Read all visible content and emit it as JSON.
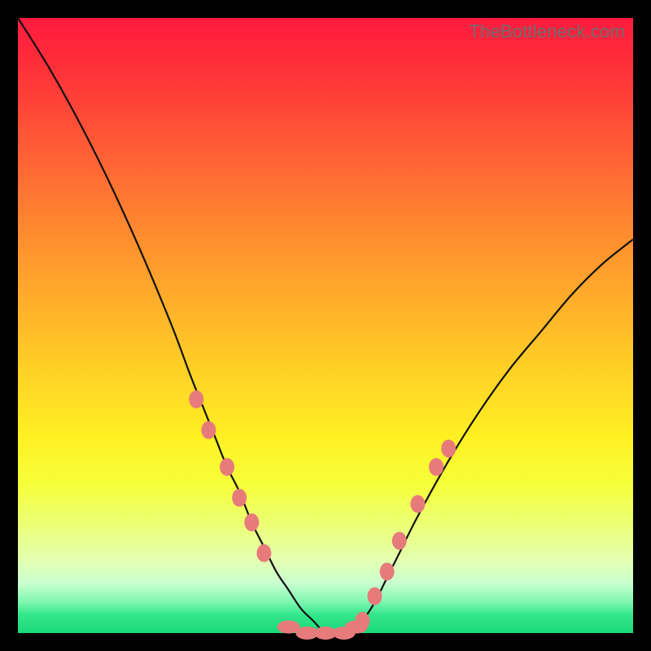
{
  "watermark": "TheBottleneck.com",
  "colors": {
    "frame": "#000000",
    "curve": "#111111",
    "blob": "#e77b7b",
    "gradient_top": "#ff1a3f",
    "gradient_bottom": "#19d877"
  },
  "chart_data": {
    "type": "line",
    "title": "",
    "xlabel": "",
    "ylabel": "",
    "xlim": [
      0,
      100
    ],
    "ylim": [
      0,
      100
    ],
    "x": [
      0,
      5,
      10,
      15,
      20,
      25,
      28,
      30,
      32,
      34,
      36,
      38,
      40,
      42,
      44,
      46,
      48,
      50,
      52,
      54,
      56,
      58,
      60,
      62,
      65,
      70,
      75,
      80,
      85,
      90,
      95,
      100
    ],
    "y": [
      100,
      92,
      83,
      73,
      62,
      50,
      42,
      37,
      32,
      27,
      23,
      18,
      14,
      10,
      7,
      4,
      2,
      0,
      0,
      0,
      2,
      5,
      9,
      13,
      19,
      28,
      36,
      43,
      49,
      55,
      60,
      64
    ],
    "markers": {
      "left_arm": [
        {
          "x": 29,
          "y": 38
        },
        {
          "x": 31,
          "y": 33
        },
        {
          "x": 34,
          "y": 27
        },
        {
          "x": 36,
          "y": 22
        },
        {
          "x": 38,
          "y": 18
        },
        {
          "x": 40,
          "y": 13
        }
      ],
      "right_arm": [
        {
          "x": 56,
          "y": 2
        },
        {
          "x": 58,
          "y": 6
        },
        {
          "x": 60,
          "y": 10
        },
        {
          "x": 62,
          "y": 15
        },
        {
          "x": 65,
          "y": 21
        },
        {
          "x": 68,
          "y": 27
        },
        {
          "x": 70,
          "y": 30
        }
      ],
      "bottom": [
        {
          "x": 44,
          "y": 1
        },
        {
          "x": 47,
          "y": 0
        },
        {
          "x": 50,
          "y": 0
        },
        {
          "x": 53,
          "y": 0
        },
        {
          "x": 55,
          "y": 1
        }
      ]
    }
  }
}
